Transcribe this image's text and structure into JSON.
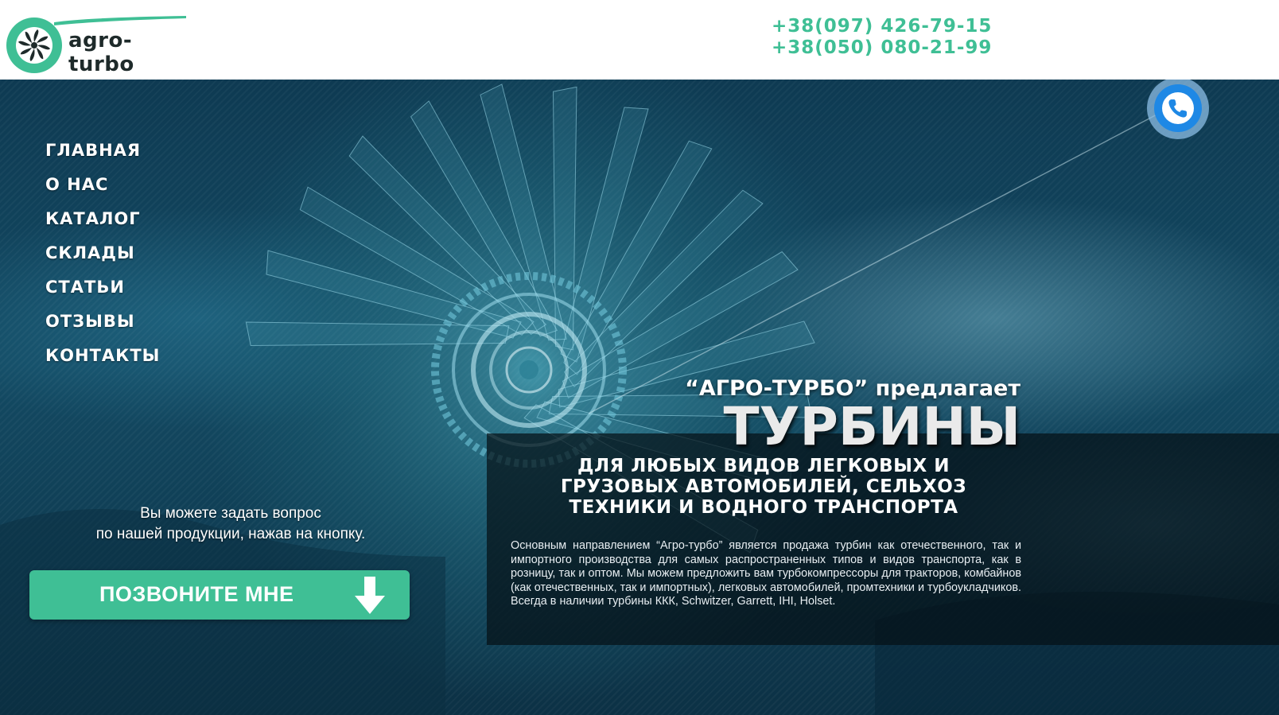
{
  "header": {
    "logo_text": "agro-turbo",
    "phones": [
      "+38(097) 426-79-15",
      "+38(050) 080-21-99"
    ]
  },
  "nav": {
    "items": [
      {
        "label": "ГЛАВНАЯ"
      },
      {
        "label": "О НАС"
      },
      {
        "label": "КАТАЛОГ"
      },
      {
        "label": "СКЛАДЫ"
      },
      {
        "label": "СТАТЬИ"
      },
      {
        "label": "ОТЗЫВЫ"
      },
      {
        "label": "КОНТАКТЫ"
      }
    ]
  },
  "hero": {
    "tagline": "“АГРО-ТУРБО” предлагает",
    "title": "ТУРБИНЫ",
    "subtitle": "ДЛЯ ЛЮБЫХ ВИДОВ ЛЕГКОВЫХ И ГРУЗОВЫХ АВТОМОБИЛЕЙ, СЕЛЬХОЗ ТЕХНИКИ И ВОДНОГО ТРАНСПОРТА",
    "description": "Основным направлением “Агро-турбо” является продажа турбин как отечественного, так и импортного производства для самых распространенных типов и видов транспорта, как в розницу, так и оптом. Мы можем предложить вам турбокомпрессоры для тракторов, комбайнов (как отечественных, так и импортных), легковых автомобилей, промтехники и турбоукладчиков. Всегда в наличии турбины ККК, Schwitzer, Garrett, IHI, Holset.",
    "question_line1": "Вы можете задать вопрос",
    "question_line2": "по нашей продукции, нажав на кнопку.",
    "call_button_label": "ПОЗВОНИТЕ МНЕ",
    "call_button_icon": "arrow-down-icon",
    "floating_button_icon": "phone-icon"
  },
  "colors": {
    "accent": "#3fbf95",
    "fab_blue": "#1e88e5",
    "hero_dark": "#0e3a52"
  }
}
